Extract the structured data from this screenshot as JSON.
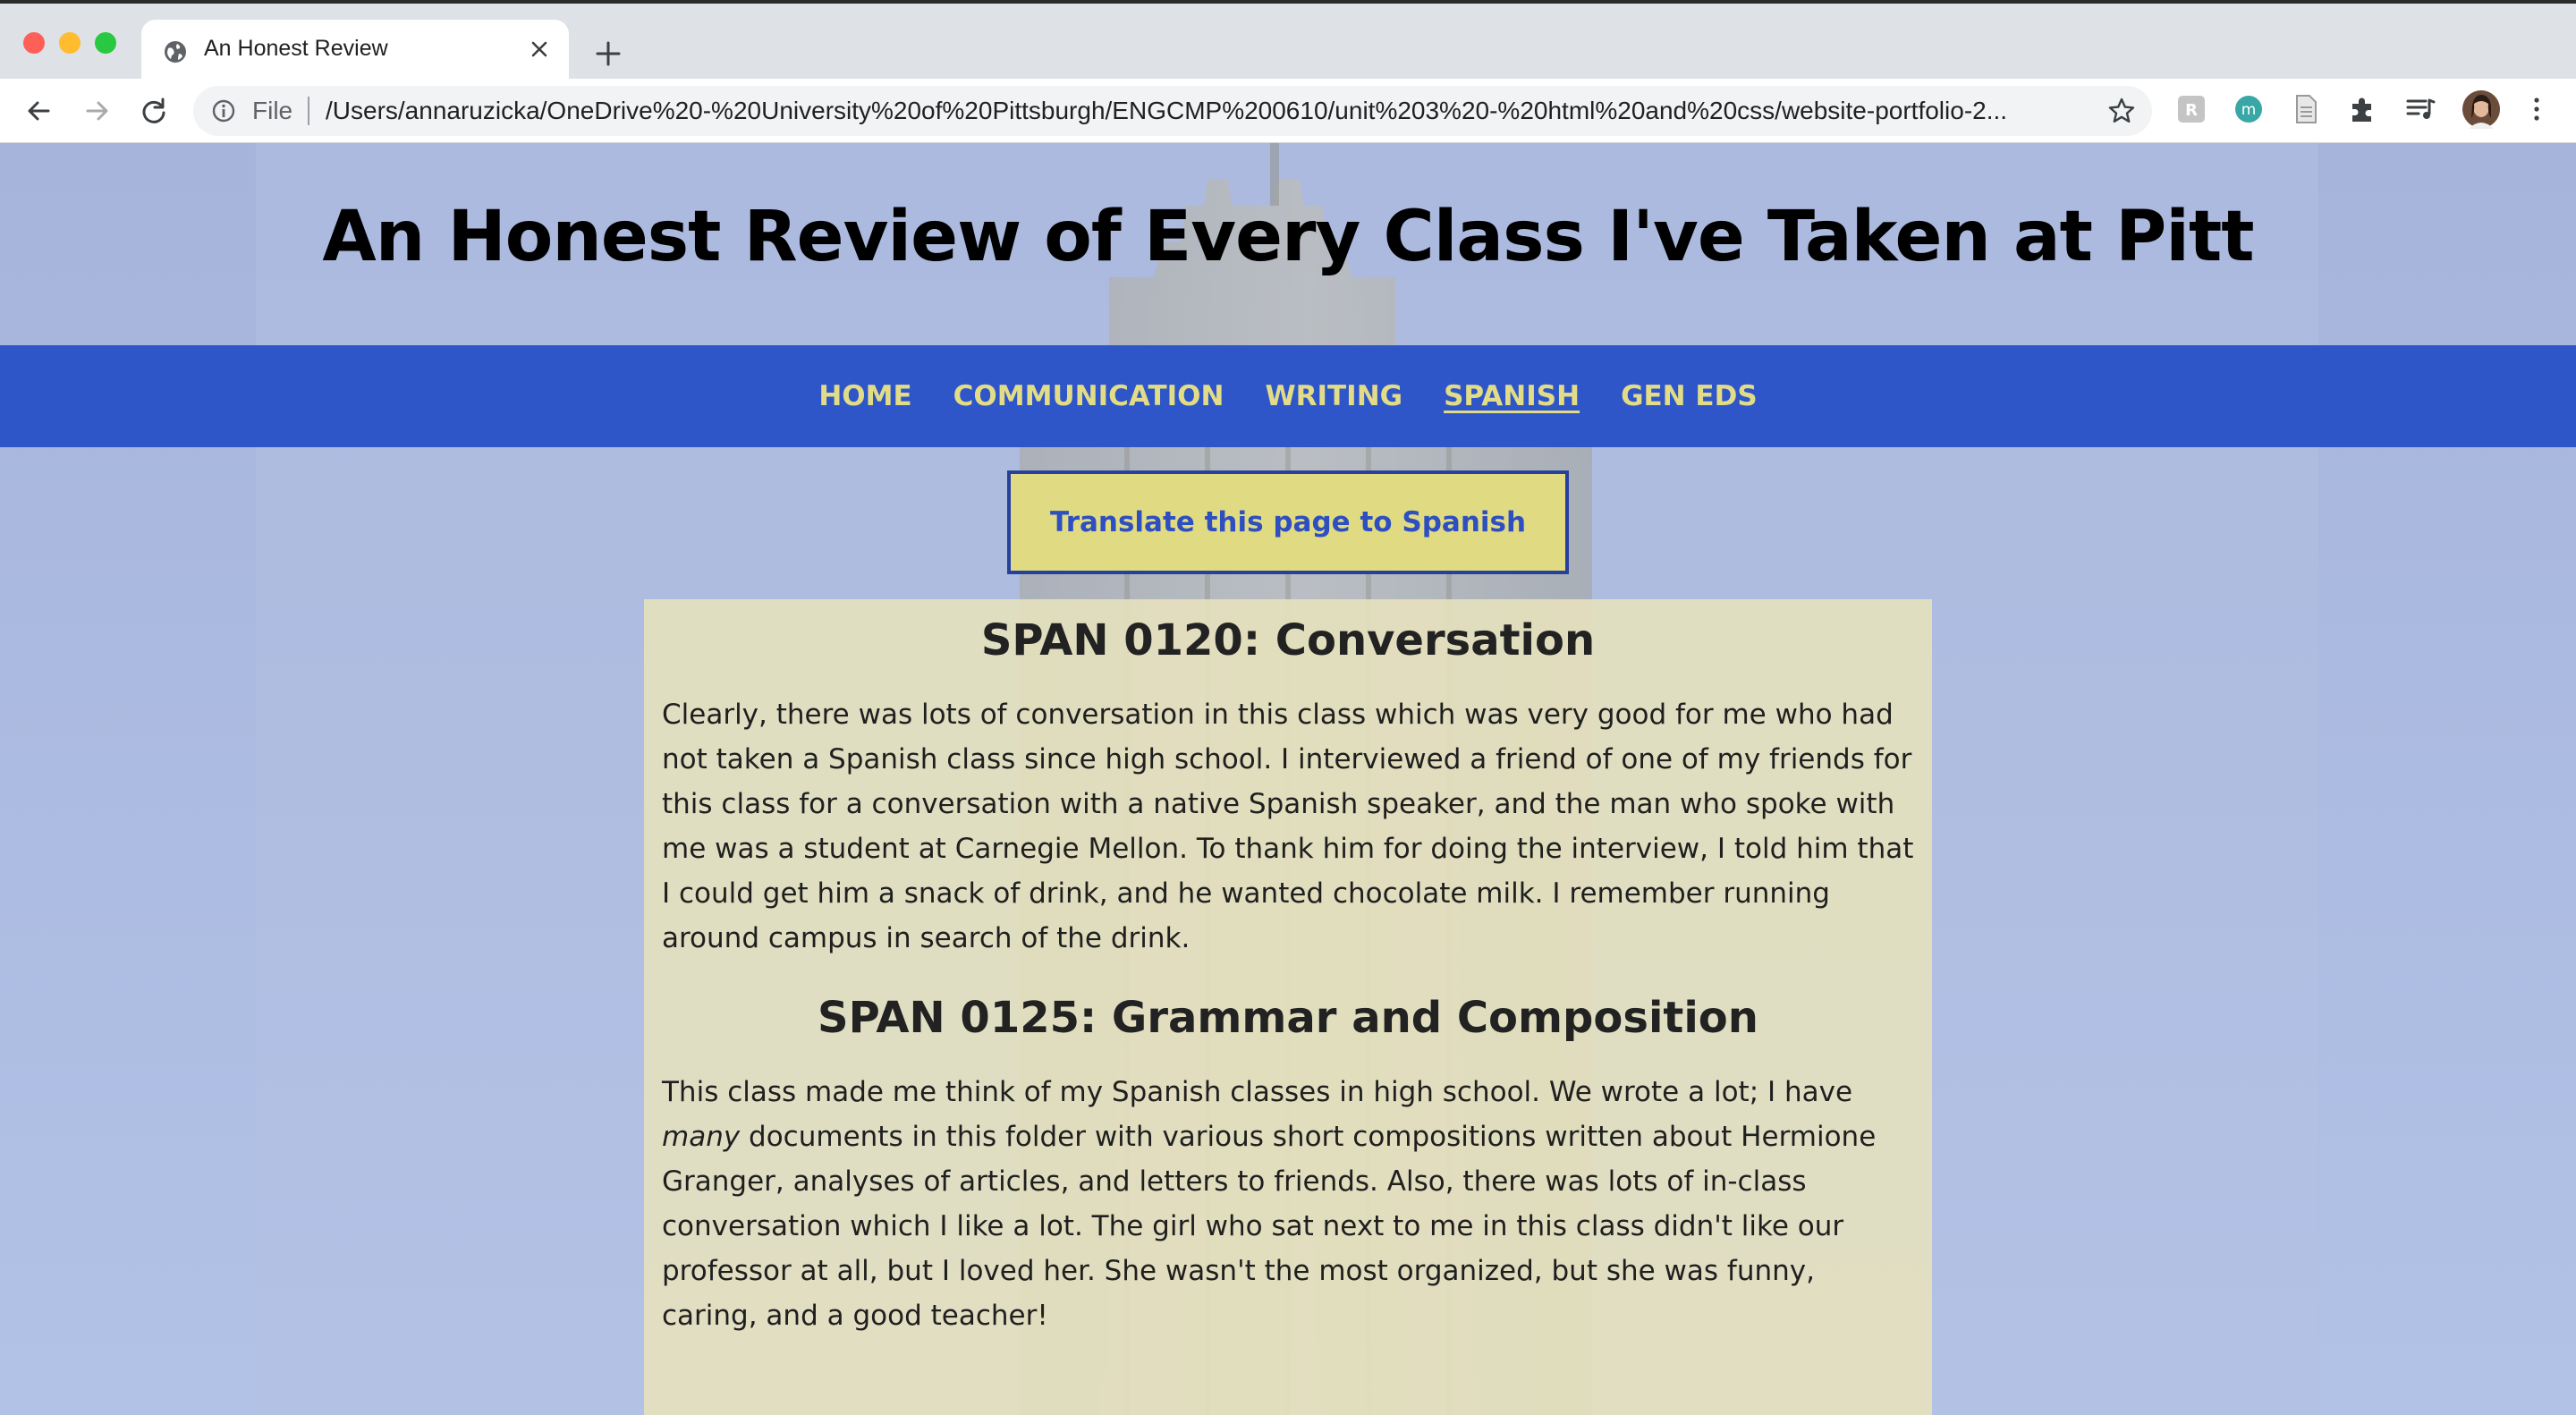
{
  "browser": {
    "tab_title": "An Honest Review",
    "file_label": "File",
    "url": "/Users/annaruzicka/OneDrive%20-%20University%20of%20Pittsburgh/ENGCMP%200610/unit%203%20-%20html%20and%20css/website-portfolio-2...",
    "extensions": [
      "translate-extension-icon",
      "m-extension-icon",
      "document-extension-icon",
      "puzzle-icon",
      "media-queue-icon",
      "profile-avatar"
    ]
  },
  "site": {
    "title": "An Honest Review of Every Class I've Taken at Pitt",
    "nav": [
      {
        "label": "HOME",
        "active": false
      },
      {
        "label": "COMMUNICATION",
        "active": false
      },
      {
        "label": "WRITING",
        "active": false
      },
      {
        "label": "SPANISH",
        "active": true
      },
      {
        "label": "GEN EDS",
        "active": false
      }
    ],
    "translate_button": "Translate this page to Spanish"
  },
  "content": {
    "sections": [
      {
        "heading": "SPAN 0120: Conversation",
        "body": "Clearly, there was lots of conversation in this class which was very good for me who had not taken a Spanish class since high school. I interviewed a friend of one of my friends for this class for a conversation with a native Spanish speaker, and the man who spoke with me was a student at Carnegie Mellon. To thank him for doing the interview, I told him that I could get him a snack of drink, and he wanted chocolate milk. I remember running around campus in search of the drink."
      },
      {
        "heading": "SPAN 0125: Grammar and Composition",
        "body_before_em": "This class made me think of my Spanish classes in high school. We wrote a lot; I have ",
        "body_em": "many",
        "body_after_em": " documents in this folder with various short compositions written about Hermione Granger, analyses of articles, and letters to friends. Also, there was lots of in-class conversation which I like a lot. The girl who sat next to me in this class didn't like our professor at all, but I loved her. She wasn't the most organized, but she was funny, caring, and a good teacher!"
      }
    ]
  },
  "colors": {
    "nav_bg": "#2e56c8",
    "nav_text": "#e3dc86",
    "button_bg": "#e0db82",
    "button_text": "#2e4fc0",
    "content_bg": "#e5e1be",
    "page_bg": "#aebde0"
  }
}
